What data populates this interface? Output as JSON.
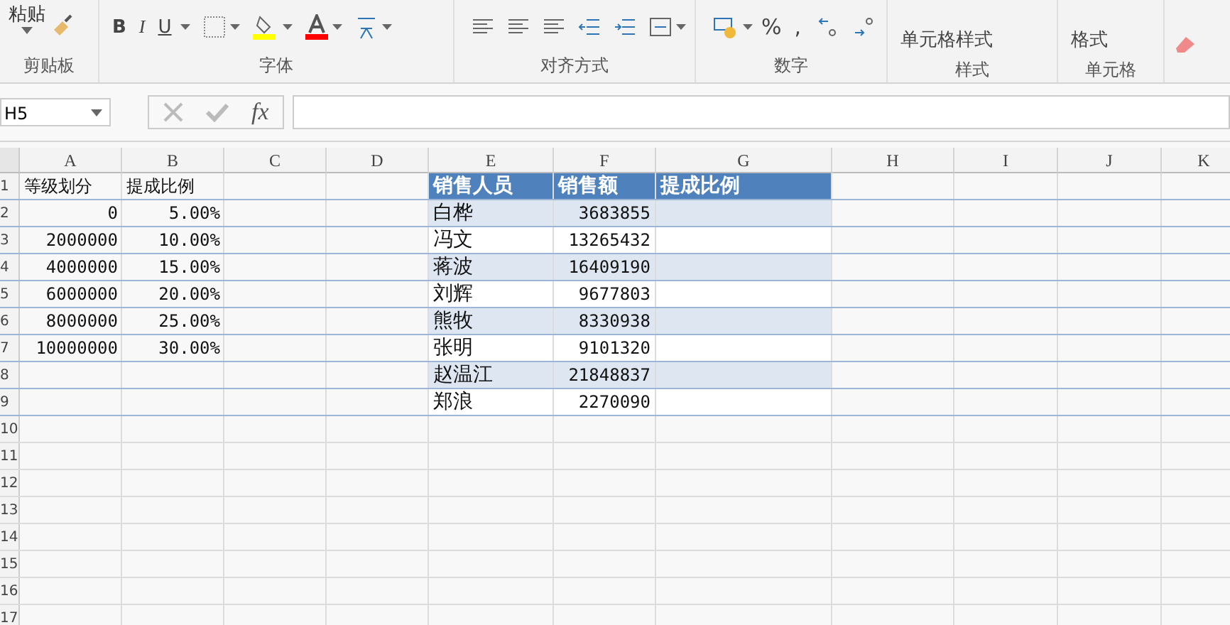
{
  "ribbon": {
    "paste_label": "粘贴",
    "bold": "B",
    "italic": "I",
    "underline": "U",
    "percent": "%",
    "comma": ",",
    "cell_styles": "单元格样式",
    "format": "格式",
    "groups": [
      "剪贴板",
      "字体",
      "对齐方式",
      "数字",
      "样式",
      "单元格"
    ]
  },
  "formula_bar": {
    "name_box": "H5",
    "fx": "fx"
  },
  "sheet": {
    "columns": [
      "A",
      "B",
      "C",
      "D",
      "E",
      "F",
      "G",
      "H",
      "I",
      "J",
      "K"
    ],
    "row_numbers": [
      "1",
      "2",
      "3",
      "4",
      "5",
      "6",
      "7",
      "8",
      "9",
      "10",
      "11",
      "12",
      "13",
      "14",
      "15",
      "16",
      "17"
    ],
    "left_table": {
      "header": [
        "等级划分",
        "提成比例"
      ],
      "rows": [
        [
          "0",
          "5.00%"
        ],
        [
          "2000000",
          "10.00%"
        ],
        [
          "4000000",
          "15.00%"
        ],
        [
          "6000000",
          "20.00%"
        ],
        [
          "8000000",
          "25.00%"
        ],
        [
          "10000000",
          "30.00%"
        ]
      ]
    },
    "right_table": {
      "header": [
        "销售人员",
        "销售额",
        "提成比例"
      ],
      "rows": [
        [
          "白桦",
          "3683855"
        ],
        [
          "冯文",
          "13265432"
        ],
        [
          "蒋波",
          "16409190"
        ],
        [
          "刘辉",
          "9677803"
        ],
        [
          "熊牧",
          "8330938"
        ],
        [
          "张明",
          "9101320"
        ],
        [
          "赵温江",
          "21848837"
        ],
        [
          "郑浪",
          "2270090"
        ]
      ]
    }
  }
}
